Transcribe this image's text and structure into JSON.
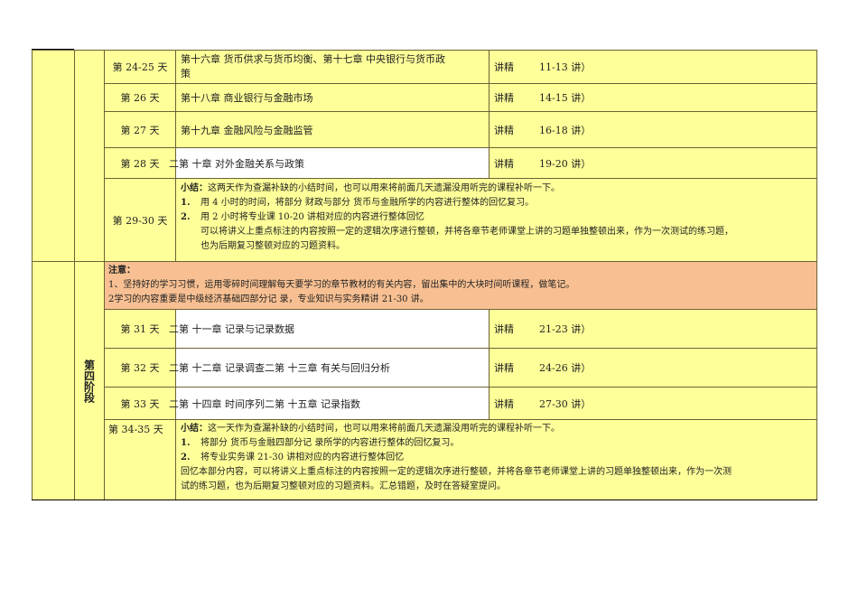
{
  "rows": [
    {
      "day": "第 24-25 天",
      "topic_line1": "第十六章  货币供求与货币均衡、第十七章  中央银行与货币政",
      "topic_line2": "策",
      "lecture": "讲精",
      "range": "11-13 讲）"
    },
    {
      "day": "第 26 天",
      "topic": "第十八章  商业银行与金融市场",
      "lecture": "讲精",
      "range": "14-15 讲）"
    },
    {
      "day": "第 27 天",
      "topic": "第十九章  金融风险与金融监管",
      "lecture": "讲精",
      "range": "16-18 讲）"
    },
    {
      "day": "第 28 天",
      "topic": "二第    十章  对外金融关系与政策",
      "lecture": "讲精",
      "range": "19-20 讲）"
    }
  ],
  "summary1": {
    "day": "第 29-30 天",
    "label": "小结：",
    "intro": "这两天作为查漏补缺的小结时间，也可以用来将前面几天遗漏没用听完的课程补听一下。",
    "n1": "1.",
    "item1": "用 4 小时的时间，将部分      财政与部分      货币与金融所学的内容进行整体的回忆复习。",
    "n2": "2.",
    "item2": "用 2 小时将专业课 10-20 讲相对应的内容进行整体回忆",
    "detail1": "可以将讲义上重点标注的内容按照一定的逻辑次序进行整顿，并将各章节老师课堂上讲的习题单独整顿出来，作为一次测试的练习题，",
    "detail2": "也为后期复习整顿对应的习题资料。"
  },
  "note": {
    "title": "注意：",
    "line1": "1、坚持好的学习习惯，运用零碎时间理解每天要学习的章节教材的有关内容，留出集中的大块时间听课程，做笔记。",
    "line2": "2学习的内容重要是中级经济基础四部分记                   录，专业知识与实务精讲       21-30 讲。"
  },
  "stage": "第四阶段",
  "rows2": [
    {
      "day": "第 31 天",
      "topic": "二第    十一章  记录与记录数据",
      "lecture": "讲精",
      "range": "21-23 讲）"
    },
    {
      "day": "第 32 天",
      "topic": "二第    十二章  记录调查二第    十三章  有关与回归分析",
      "lecture": "讲精",
      "range": "24-26 讲）"
    },
    {
      "day": "第 33 天",
      "topic": "二第    十四章  时间序列二第    十五章  记录指数",
      "lecture": "讲精",
      "range": "27-30 讲）"
    }
  ],
  "summary2": {
    "day": "第 34-35 天",
    "label": "小结：",
    "intro": "这一天作为查漏补缺的小结时间，也可以用来将前面几天遗漏没用听完的课程补听一下。",
    "n1": "1.",
    "item1": "将部分      货币与金融四部分记      录所学的内容进行整体的回忆复习。",
    "n2": "2.",
    "item2": "将专业实务课 21-30 讲相对应的内容进行整体回忆",
    "detail1": "回忆本部分内容，可以将讲义上重点标注的内容按照一定的逻辑次序进行整顿，并将各章节老师课堂上讲的习题单独整顿出来，作为一次测",
    "detail2": "试的练习题，也为后期复习整顿对应的习题资料。汇总错题，及时在答疑室提问。"
  }
}
